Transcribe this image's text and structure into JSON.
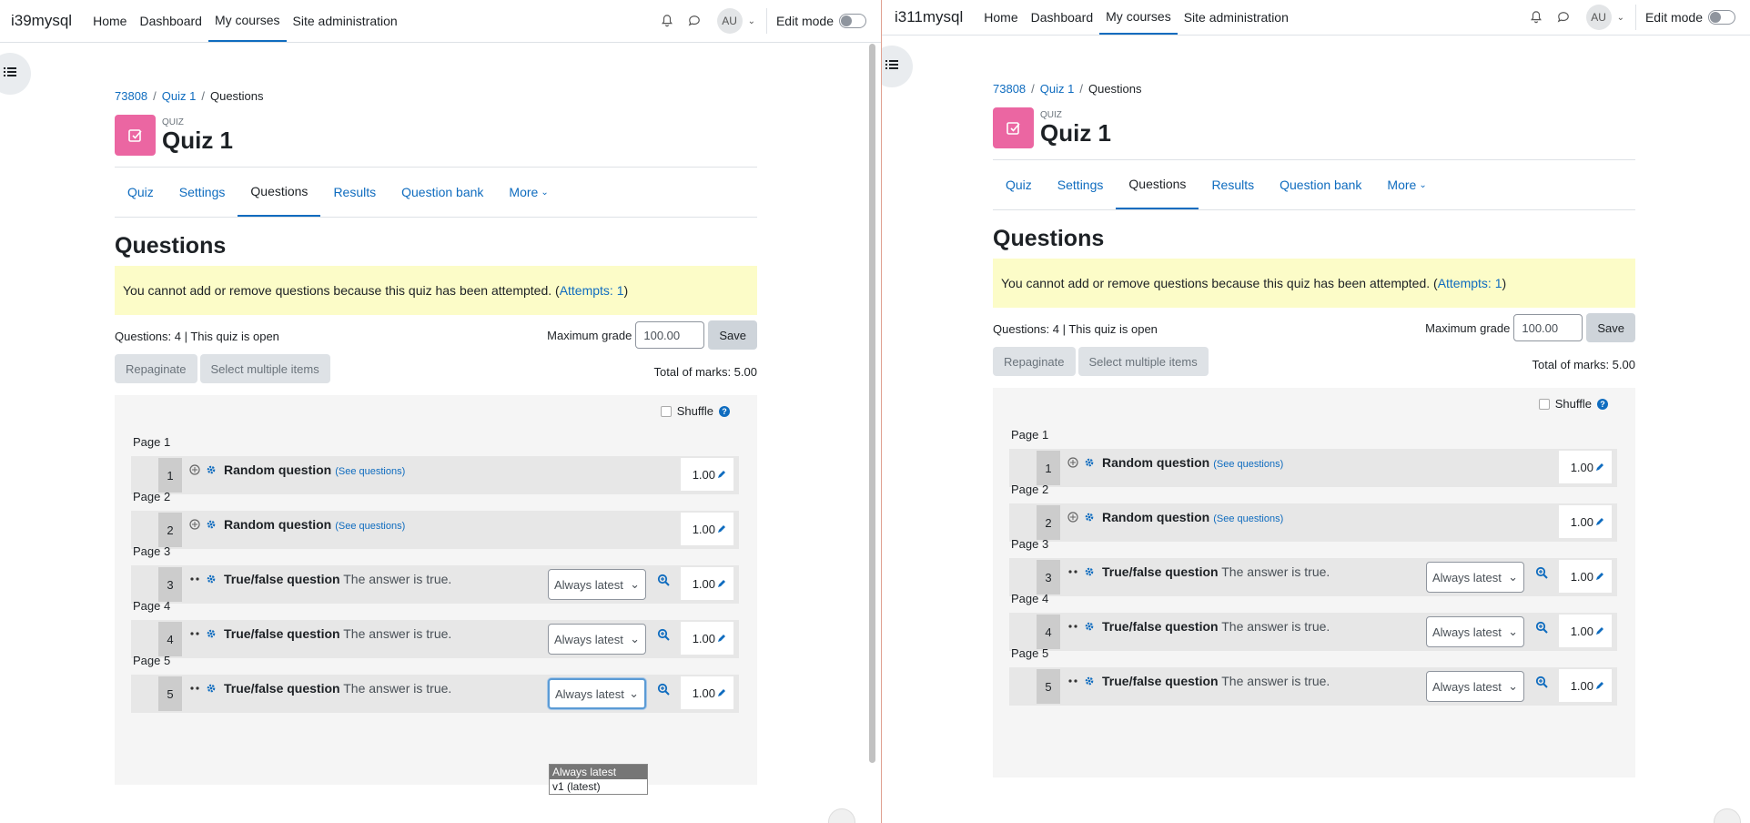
{
  "left": {
    "site_name": "i39mysql",
    "nav": [
      "Home",
      "Dashboard",
      "My courses",
      "Site administration"
    ],
    "active_nav": "My courses",
    "avatar": "AU",
    "edit_mode": "Edit mode",
    "breadcrumb": [
      "73808",
      "Quiz 1",
      "Questions"
    ],
    "header_small": "QUIZ",
    "header_title": "Quiz 1",
    "tabs": [
      "Quiz",
      "Settings",
      "Questions",
      "Results",
      "Question bank",
      "More"
    ],
    "page_title": "Questions",
    "notice_text": "You cannot add or remove questions because this quiz has been attempted. (",
    "notice_link": "Attempts: 1",
    "notice_end": ")",
    "status": "Questions: 4 | This quiz is open",
    "max_grade_label": "Maximum grade",
    "max_grade_value": "100.00",
    "save": "Save",
    "repaginate": "Repaginate",
    "select_multiple": "Select multiple items",
    "total_marks": "Total of marks: 5.00",
    "shuffle": "Shuffle",
    "pages": [
      "Page 1",
      "Page 2",
      "Page 3",
      "Page 4",
      "Page 5"
    ],
    "questions": [
      {
        "num": "1",
        "title": "Random question",
        "extra": "(See questions)",
        "mark": "1.00"
      },
      {
        "num": "2",
        "title": "Random question",
        "extra": "(See questions)",
        "mark": "1.00"
      },
      {
        "num": "3",
        "title": "True/false question",
        "text": "The answer is true.",
        "version": "Always latest",
        "mark": "1.00"
      },
      {
        "num": "4",
        "title": "True/false question",
        "text": "The answer is true.",
        "version": "Always latest",
        "mark": "1.00"
      },
      {
        "num": "5",
        "title": "True/false question",
        "text": "The answer is true.",
        "version": "Always latest",
        "mark": "1.00"
      }
    ],
    "dropdown_options": [
      "Always latest",
      "v1 (latest)"
    ]
  },
  "right": {
    "site_name": "i311mysql",
    "nav": [
      "Home",
      "Dashboard",
      "My courses",
      "Site administration"
    ],
    "active_nav": "My courses",
    "avatar": "AU",
    "edit_mode": "Edit mode",
    "breadcrumb": [
      "73808",
      "Quiz 1",
      "Questions"
    ],
    "header_small": "QUIZ",
    "header_title": "Quiz 1",
    "tabs": [
      "Quiz",
      "Settings",
      "Questions",
      "Results",
      "Question bank",
      "More"
    ],
    "page_title": "Questions",
    "notice_text": "You cannot add or remove questions because this quiz has been attempted. (",
    "notice_link": "Attempts: 1",
    "notice_end": ")",
    "status": "Questions: 4 | This quiz is open",
    "max_grade_label": "Maximum grade",
    "max_grade_value": "100.00",
    "save": "Save",
    "repaginate": "Repaginate",
    "select_multiple": "Select multiple items",
    "total_marks": "Total of marks: 5.00",
    "shuffle": "Shuffle",
    "pages": [
      "Page 1",
      "Page 2",
      "Page 3",
      "Page 4",
      "Page 5"
    ],
    "questions": [
      {
        "num": "1",
        "title": "Random question",
        "extra": "(See questions)",
        "mark": "1.00"
      },
      {
        "num": "2",
        "title": "Random question",
        "extra": "(See questions)",
        "mark": "1.00"
      },
      {
        "num": "3",
        "title": "True/false question",
        "text": "The answer is true.",
        "version": "Always latest",
        "mark": "1.00"
      },
      {
        "num": "4",
        "title": "True/false question",
        "text": "The answer is true.",
        "version": "Always latest",
        "mark": "1.00"
      },
      {
        "num": "5",
        "title": "True/false question",
        "text": "The answer is true.",
        "version": "Always latest",
        "mark": "1.00"
      }
    ]
  },
  "icons": {
    "notifications": "bell-icon",
    "messages": "chat-icon",
    "drawer": "list-icon",
    "question_settings": "gear-icon",
    "random": "random-icon",
    "move": "drag-dots-icon",
    "preview": "zoom-in-icon",
    "edit_mark": "pencil-icon"
  },
  "colors": {
    "accent": "#0f6cbf",
    "quiz_icon": "#eb66a2",
    "notice_bg": "#fcfcc8"
  }
}
